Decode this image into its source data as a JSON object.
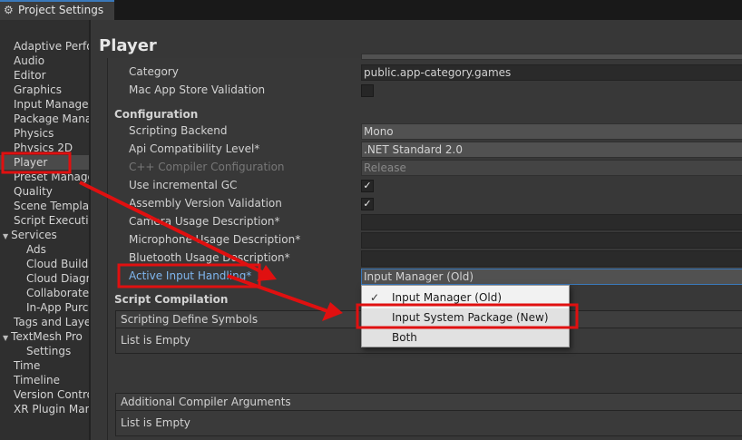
{
  "window": {
    "title": "Project Settings",
    "icon": "gear-icon"
  },
  "sidebar": {
    "items": [
      {
        "label": "Adaptive Performance",
        "indent": 0
      },
      {
        "label": "Audio",
        "indent": 0
      },
      {
        "label": "Editor",
        "indent": 0
      },
      {
        "label": "Graphics",
        "indent": 0
      },
      {
        "label": "Input Manager",
        "indent": 0
      },
      {
        "label": "Package Manager",
        "indent": 0
      },
      {
        "label": "Physics",
        "indent": 0
      },
      {
        "label": "Physics 2D",
        "indent": 0
      },
      {
        "label": "Player",
        "indent": 0,
        "selected": true
      },
      {
        "label": "Preset Manager",
        "indent": 0
      },
      {
        "label": "Quality",
        "indent": 0
      },
      {
        "label": "Scene Template",
        "indent": 0
      },
      {
        "label": "Script Execution Order",
        "indent": 0
      },
      {
        "label": "Services",
        "indent": 0,
        "expanded": true
      },
      {
        "label": "Ads",
        "indent": 1
      },
      {
        "label": "Cloud Build",
        "indent": 1
      },
      {
        "label": "Cloud Diagnostics",
        "indent": 1
      },
      {
        "label": "Collaborate",
        "indent": 1
      },
      {
        "label": "In-App Purchasing",
        "indent": 1
      },
      {
        "label": "Tags and Layers",
        "indent": 0
      },
      {
        "label": "TextMesh Pro",
        "indent": 0,
        "expanded": true
      },
      {
        "label": "Settings",
        "indent": 1
      },
      {
        "label": "Time",
        "indent": 0
      },
      {
        "label": "Timeline",
        "indent": 0
      },
      {
        "label": "Version Control",
        "indent": 0
      },
      {
        "label": "XR Plugin Management",
        "indent": 0
      }
    ]
  },
  "main": {
    "title": "Player",
    "rows": {
      "category": {
        "label": "Category",
        "value": "public.app-category.games"
      },
      "mac_store": {
        "label": "Mac App Store Validation",
        "checked": false
      },
      "configuration": "Configuration",
      "backend": {
        "label": "Scripting Backend",
        "value": "Mono"
      },
      "api": {
        "label": "Api Compatibility Level*",
        "value": ".NET Standard 2.0"
      },
      "cpp": {
        "label": "C++ Compiler Configuration",
        "value": "Release"
      },
      "incgc": {
        "label": "Use incremental GC",
        "checked": true,
        "check_glyph": "✓"
      },
      "asmval": {
        "label": "Assembly Version Validation",
        "checked": true,
        "check_glyph": "✓"
      },
      "camera": {
        "label": "Camera Usage Description*",
        "value": ""
      },
      "mic": {
        "label": "Microphone Usage Description*",
        "value": ""
      },
      "bt": {
        "label": "Bluetooth Usage Description*",
        "value": ""
      },
      "input": {
        "label": "Active Input Handling*",
        "value": "Input Manager (Old)"
      }
    },
    "script_compilation": "Script Compilation",
    "define_symbols": {
      "header": "Scripting Define Symbols",
      "body": "List is Empty"
    },
    "compiler_args": {
      "header": "Additional Compiler Arguments",
      "body": "List is Empty"
    }
  },
  "dropdown": {
    "options": [
      {
        "label": "Input Manager (Old)",
        "checked": true,
        "check_glyph": "✓"
      },
      {
        "label": "Input System Package (New)",
        "checked": false,
        "check_glyph": ""
      },
      {
        "label": "Both",
        "checked": false,
        "check_glyph": ""
      }
    ]
  },
  "annotation_color": "#e01010"
}
